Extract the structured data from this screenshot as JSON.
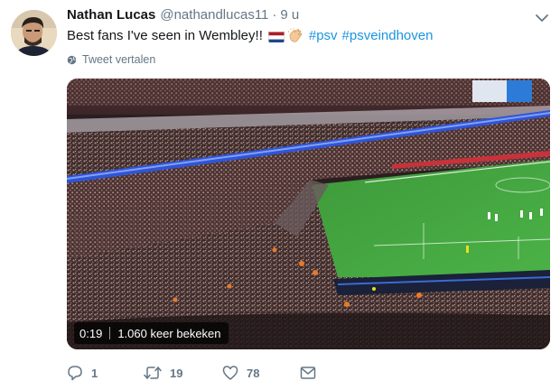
{
  "tweet": {
    "author_name": "Nathan Lucas",
    "author_handle": "@nathandlucas11",
    "separator": "·",
    "time": "9 u",
    "text": "Best fans I've seen in Wembley!!",
    "emoji": [
      "dutch-flag",
      "clapping-hands"
    ],
    "hashtags": [
      "#psv",
      "#psveindhoven"
    ],
    "translate_label": "Tweet vertalen"
  },
  "video": {
    "duration": "0:19",
    "views": "1.060 keer bekeken"
  },
  "actions": {
    "reply_count": "1",
    "retweet_count": "19",
    "like_count": "78"
  },
  "icons": {
    "reply": "reply-icon",
    "retweet": "retweet-icon",
    "like": "heart-icon",
    "message": "envelope-icon",
    "caret": "chevron-down-icon",
    "translate": "globe-icon"
  },
  "colors": {
    "link": "#1b95e0",
    "secondary_text": "#657786",
    "primary_text": "#14171a"
  }
}
